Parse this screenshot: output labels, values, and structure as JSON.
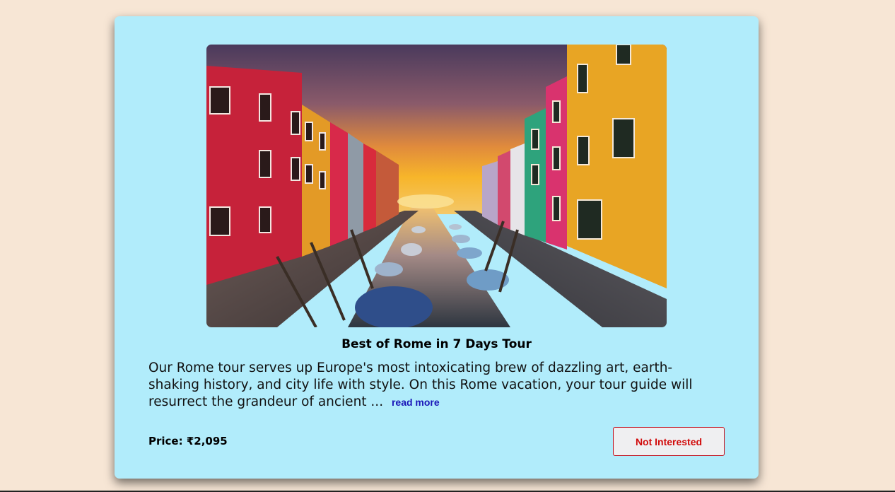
{
  "tour": {
    "image_alt": "Venice canal with colorful houses at sunset",
    "title": "Best of Rome in 7 Days Tour",
    "description": "Our Rome tour serves up Europe's most intoxicating brew of dazzling art, earth-shaking history, and city life with style. On this Rome vacation, your tour guide will resurrect the grandeur of ancient ...",
    "read_more": "read more",
    "price": "Price: ₹2,095",
    "not_interested_label": "Not Interested"
  },
  "colors": {
    "page_bg": "#f7e6d5",
    "card_bg": "#b1ecfb",
    "link": "#1a16b8",
    "button_text": "#d10b0b",
    "button_border": "#c1121f"
  }
}
